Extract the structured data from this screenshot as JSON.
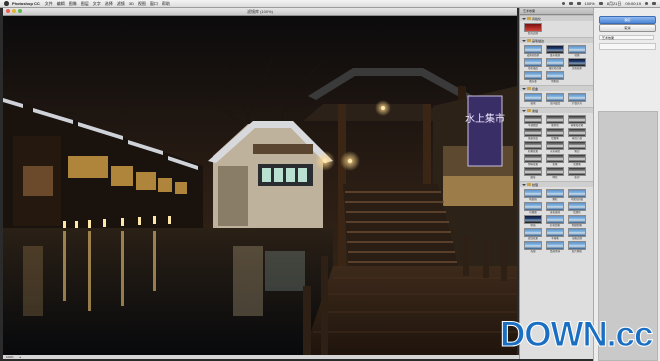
{
  "menubar": {
    "app_name": "Photoshop CC",
    "menus": [
      "文件",
      "编辑",
      "图像",
      "图层",
      "文字",
      "选择",
      "滤镜",
      "3D",
      "视图",
      "窗口",
      "帮助"
    ],
    "date_text": "8月21日",
    "time_text": "09:00:19",
    "zoom_text": "100%"
  },
  "document": {
    "title": "滤镜库 (100%)",
    "zoom": "100%",
    "sign_text": "水上集市"
  },
  "panel": {
    "header": "艺术效果",
    "groups": [
      {
        "name": "风格化",
        "items": [
          {
            "label": "照亮边缘",
            "style": "red"
          }
        ]
      },
      {
        "name": "画笔描边",
        "items": [
          {
            "label": "成角的线条",
            "style": "blue"
          },
          {
            "label": "墨水轮廓",
            "style": "dark"
          },
          {
            "label": "喷溅",
            "style": "blue"
          },
          {
            "label": "喷色描边",
            "style": "blue"
          },
          {
            "label": "强化的边缘",
            "style": "blue"
          },
          {
            "label": "深色线条",
            "style": "dark"
          },
          {
            "label": "烟灰墨",
            "style": "blue"
          },
          {
            "label": "阴影线",
            "style": "blue"
          }
        ]
      },
      {
        "name": "扭曲",
        "items": [
          {
            "label": "玻璃",
            "style": "blue"
          },
          {
            "label": "海洋波纹",
            "style": "blue"
          },
          {
            "label": "扩散亮光",
            "style": "blue"
          }
        ]
      },
      {
        "name": "素描",
        "items": [
          {
            "label": "半调图案",
            "style": "bw"
          },
          {
            "label": "便条纸",
            "style": "bw"
          },
          {
            "label": "粉笔和炭笔",
            "style": "bw"
          },
          {
            "label": "铬黄渐变",
            "style": "bw"
          },
          {
            "label": "绘图笔",
            "style": "bw"
          },
          {
            "label": "基底凸现",
            "style": "bw"
          },
          {
            "label": "石膏效果",
            "style": "bw"
          },
          {
            "label": "水彩画纸",
            "style": "bw"
          },
          {
            "label": "撕边",
            "style": "bw"
          },
          {
            "label": "塑料效果",
            "style": "bw"
          },
          {
            "label": "炭笔",
            "style": "bw"
          },
          {
            "label": "炭精笔",
            "style": "bw"
          },
          {
            "label": "图章",
            "style": "bw"
          },
          {
            "label": "网状",
            "style": "bw"
          },
          {
            "label": "影印",
            "style": "bw"
          }
        ]
      },
      {
        "name": "纹理",
        "items": [
          {
            "label": "龟裂缝",
            "style": "blue"
          },
          {
            "label": "颗粒",
            "style": "blue"
          },
          {
            "label": "马赛克拼贴",
            "style": "blue"
          },
          {
            "label": "拼缀图",
            "style": "blue"
          },
          {
            "label": "染色玻璃",
            "style": "blue"
          },
          {
            "label": "纹理化",
            "style": "blue"
          },
          {
            "label": "壁画",
            "style": "dark"
          },
          {
            "label": "彩色铅笔",
            "style": "blue"
          },
          {
            "label": "粗糙蜡笔",
            "style": "blue"
          },
          {
            "label": "底纹效果",
            "style": "blue"
          },
          {
            "label": "干画笔",
            "style": "blue"
          },
          {
            "label": "海报边缘",
            "style": "blue"
          },
          {
            "label": "海绵",
            "style": "blue"
          },
          {
            "label": "绘画涂抹",
            "style": "blue"
          },
          {
            "label": "胶片颗粒",
            "style": "blue"
          }
        ]
      }
    ]
  },
  "props": {
    "ok_label": "确定",
    "cancel_label": "取消",
    "filter_select": "艺术效果"
  },
  "watermark": {
    "text": "DOWN.cc"
  }
}
